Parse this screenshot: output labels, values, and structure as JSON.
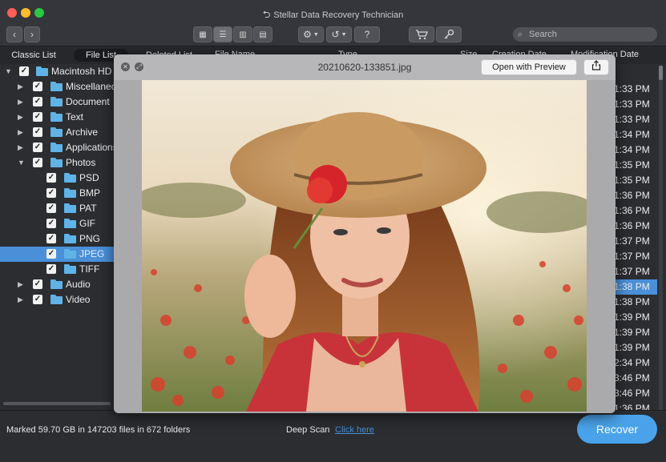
{
  "window": {
    "title": "Stellar Data Recovery Technician"
  },
  "toolbar": {
    "search_placeholder": "Search"
  },
  "tabs": {
    "classic_list": "Classic List",
    "file_list": "File List",
    "deleted_list": "Deleted List"
  },
  "columns": {
    "file_name": "File Name",
    "type": "Type",
    "size": "Size",
    "creation_date": "Creation Date",
    "modification_date": "Modification Date"
  },
  "tree": [
    {
      "label": "Macintosh HD",
      "level": 0,
      "expanded": true
    },
    {
      "label": "Miscellaneous",
      "level": 1,
      "expanded": false
    },
    {
      "label": "Document",
      "level": 1,
      "expanded": false
    },
    {
      "label": "Text",
      "level": 1,
      "expanded": false
    },
    {
      "label": "Archive",
      "level": 1,
      "expanded": false
    },
    {
      "label": "Applications",
      "level": 1,
      "expanded": false
    },
    {
      "label": "Photos",
      "level": 1,
      "expanded": true
    },
    {
      "label": "PSD",
      "level": 2
    },
    {
      "label": "BMP",
      "level": 2
    },
    {
      "label": "PAT",
      "level": 2
    },
    {
      "label": "GIF",
      "level": 2
    },
    {
      "label": "PNG",
      "level": 2
    },
    {
      "label": "JPEG",
      "level": 2,
      "selected": true
    },
    {
      "label": "TIFF",
      "level": 2
    },
    {
      "label": "Audio",
      "level": 1,
      "expanded": false
    },
    {
      "label": "Video",
      "level": 1,
      "expanded": false
    }
  ],
  "modification_times": [
    "1:33 PM",
    "1:33 PM",
    "1:33 PM",
    "1:34 PM",
    "1:34 PM",
    "1:35 PM",
    "1:35 PM",
    "1:36 PM",
    "1:36 PM",
    "1:36 PM",
    "1:37 PM",
    "1:37 PM",
    "1:37 PM",
    "1:38 PM",
    "1:38 PM",
    "1:39 PM",
    "1:39 PM",
    "1:39 PM",
    "2:34 PM",
    "3:46 PM",
    "3:46 PM",
    "1:36 PM"
  ],
  "selected_time_index": 13,
  "status": {
    "marked": "Marked 59.70 GB in 147203 files in 672 folders",
    "deep_scan": "Deep Scan",
    "click_here": "Click here",
    "recover": "Recover"
  },
  "preview": {
    "filename": "20210620-133851.jpg",
    "open_with_preview": "Open with Preview"
  },
  "colors": {
    "accent": "#4a90d9",
    "recover_button": "#4aa3ea",
    "folder": "#5fb3e6"
  },
  "icons": [
    "back-icon",
    "forward-icon",
    "icon-view-icon",
    "list-view-icon",
    "column-view-icon",
    "coverflow-view-icon",
    "gear-icon",
    "history-icon",
    "help-icon",
    "cart-icon",
    "key-icon",
    "search-icon",
    "close-icon",
    "fullscreen-icon",
    "share-icon",
    "folder-icon",
    "disk-icon"
  ]
}
